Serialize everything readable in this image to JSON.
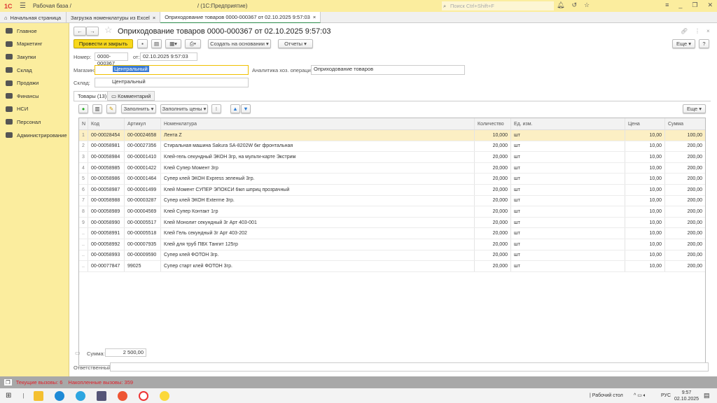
{
  "titlebar": {
    "logo": "1С",
    "title": "Рабочая база /",
    "suffix": "/ (1С:Предприятие)",
    "search_placeholder": "Поиск Ctrl+Shift+F"
  },
  "tabs": [
    {
      "label": "Начальная страница"
    },
    {
      "label": "Загрузка номенклатуры из Excel"
    },
    {
      "label": "Оприходование товаров 0000-000367 от 02.10.2025 9:57:03"
    }
  ],
  "sidebar": {
    "items": [
      {
        "label": "Главное"
      },
      {
        "label": "Маркетинг"
      },
      {
        "label": "Закупки"
      },
      {
        "label": "Склад"
      },
      {
        "label": "Продажи"
      },
      {
        "label": "Финансы"
      },
      {
        "label": "НСИ"
      },
      {
        "label": "Персонал"
      },
      {
        "label": "Администрирование"
      }
    ]
  },
  "form": {
    "title": "Оприходование товаров 0000-000367 от 02.10.2025 9:57:03",
    "post_close": "Провести и закрыть",
    "create_based": "Создать на основании",
    "reports": "Отчеты",
    "more": "Еще",
    "help": "?",
    "number_label": "Номер:",
    "number": "0000-000367",
    "date_label": "от:",
    "date": "02.10.2025  9:57:03",
    "store_label": "Магазин:",
    "store": "Центральный",
    "analytics_label": "Аналитика хоз. операции:",
    "analytics": "Оприходование товаров",
    "warehouse_label": "Склад:",
    "warehouse": "Центральный",
    "tab_goods": "Товары (13)",
    "tab_comment": "Комментарий",
    "fill": "Заполнить",
    "fill_prices": "Заполнить цены",
    "table_more": "Еще",
    "sum_label": "Сумма:",
    "sum": "2 500,00",
    "responsible_label": "Ответственный:",
    "responsible": ""
  },
  "table": {
    "columns": [
      "N",
      "Код",
      "Артикул",
      "Номенклатура",
      "Количество",
      "Ед. изм.",
      "Цена",
      "Сумма"
    ],
    "rows": [
      [
        "1",
        "00-00028454",
        "00-00024658",
        "Лента Z",
        "10,000",
        "шт",
        "10,00",
        "100,00"
      ],
      [
        "2",
        "00-00058981",
        "00-00027356",
        "Стиральная машина Sakura SA-8202W 6кг фронтальная",
        "20,000",
        "шт",
        "10,00",
        "200,00"
      ],
      [
        "3",
        "00-00058984",
        "00-00001410",
        "Клей-гель секундный ЭКОН 3гр, на мульти-карте Экстрим",
        "20,000",
        "шт",
        "10,00",
        "200,00"
      ],
      [
        "4",
        "00-00058985",
        "00-00001422",
        "Клей Супер Момент 3гр",
        "20,000",
        "шт",
        "10,00",
        "200,00"
      ],
      [
        "5",
        "00-00058986",
        "00-00001464",
        "Супер клей ЭКОН Express зеленый 3гр.",
        "20,000",
        "шт",
        "10,00",
        "200,00"
      ],
      [
        "6",
        "00-00058987",
        "00-00001499",
        "Клей Момент СУПЕР ЭПОКСИ 6мл шприц прозрачный",
        "20,000",
        "шт",
        "10,00",
        "200,00"
      ],
      [
        "7",
        "00-00058988",
        "00-00003287",
        "Супер клей ЭКОН Exterme 3гр.",
        "20,000",
        "шт",
        "10,00",
        "200,00"
      ],
      [
        "8",
        "00-00058989",
        "00-00004569",
        "Клей Супер Контакт 1гр",
        "20,000",
        "шт",
        "10,00",
        "200,00"
      ],
      [
        "9",
        "00-00058990",
        "00-00005517",
        "Клей Монолит секундный 3г Арт 403-001",
        "20,000",
        "шт",
        "10,00",
        "200,00"
      ],
      [
        "..",
        "00-00058991",
        "00-00005518",
        "Клей Гель секундный 3г Арт 403-202",
        "20,000",
        "шт",
        "10,00",
        "200,00"
      ],
      [
        "..",
        "00-00058992",
        "00-00007935",
        "Клей для труб ПВХ Тангит 125гр",
        "20,000",
        "шт",
        "10,00",
        "200,00"
      ],
      [
        "..",
        "00-00058993",
        "00-00009590",
        "Супер клей ФОТОН 3гр.",
        "20,000",
        "шт",
        "10,00",
        "200,00"
      ],
      [
        "..",
        "00-00077847",
        "99025",
        "Супер старт клей ФОТОН 3гр.",
        "20,000",
        "шт",
        "10,00",
        "200,00"
      ]
    ]
  },
  "status": {
    "current_calls": "Текущие вызовы: 6",
    "accumulated_calls": "Накопленные вызовы: 359"
  },
  "taskbar": {
    "desktop": "Рабочий стол",
    "lang": "РУС",
    "time": "9:57",
    "date": "02.10.2025"
  },
  "colors": {
    "accent": "#f8d81c",
    "sidebar": "#fbed9e",
    "selected_row": "#fcefc4",
    "status_text": "#e0202a"
  }
}
